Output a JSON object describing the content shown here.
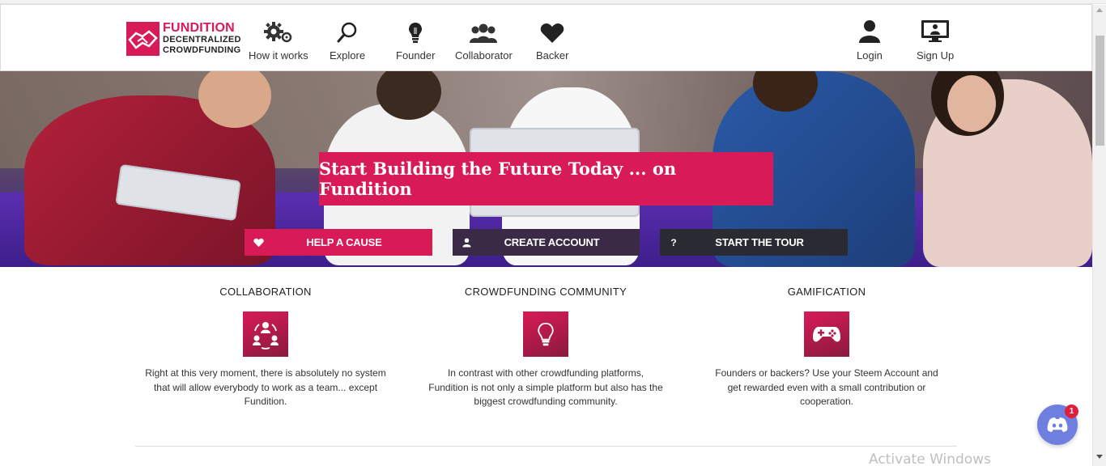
{
  "brand": {
    "line1": "FUNDITION",
    "line2": "DECENTRALIZED",
    "line3": "CROWDFUNDING",
    "color": "#d81b56"
  },
  "nav": {
    "left": [
      {
        "label": "How it works",
        "icon": "gears-icon"
      },
      {
        "label": "Explore",
        "icon": "search-icon"
      },
      {
        "label": "Founder",
        "icon": "lightbulb-icon"
      },
      {
        "label": "Collaborator",
        "icon": "users-icon"
      },
      {
        "label": "Backer",
        "icon": "heart-icon"
      }
    ],
    "right": [
      {
        "label": "Login",
        "icon": "user-icon"
      },
      {
        "label": "Sign Up",
        "icon": "monitor-user-icon"
      }
    ]
  },
  "hero": {
    "headline": "Start Building the Future Today ... on Fundition",
    "buttons": [
      {
        "label": "HELP A CAUSE",
        "icon": "heart-icon",
        "color": "#d81b56"
      },
      {
        "label": "CREATE ACCOUNT",
        "icon": "user-icon",
        "color": "#3a2a45"
      },
      {
        "label": "START THE TOUR",
        "icon": "question-icon",
        "color": "#2a2a32"
      }
    ]
  },
  "features": [
    {
      "title": "COLLABORATION",
      "icon": "team-cycle-icon",
      "text": "Right at this very moment, there is absolutely no system that will allow everybody to work as a team... except Fundition."
    },
    {
      "title": "CROWDFUNDING COMMUNITY",
      "icon": "lightbulb-icon",
      "text": "In contrast with other crowdfunding platforms, Fundition is not only a simple platform but also has the biggest crowdfunding community."
    },
    {
      "title": "GAMIFICATION",
      "icon": "gamepad-icon",
      "text": "Founders or backers? Use your Steem Account and get rewarded even with a small contribution or cooperation."
    }
  ],
  "chat": {
    "icon": "discord-icon",
    "badge_count": "1",
    "color": "#6f7fe0"
  },
  "os_watermark": "Activate Windows"
}
